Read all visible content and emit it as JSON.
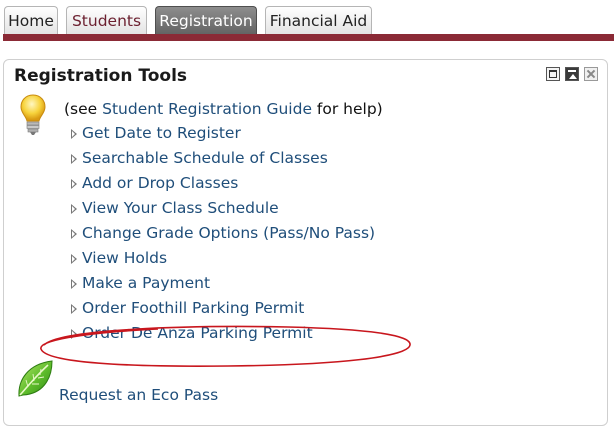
{
  "tabs": {
    "home": "Home",
    "students": "Students",
    "registration": "Registration",
    "financial_aid": "Financial Aid"
  },
  "portlet": {
    "title": "Registration Tools",
    "help_prefix": "(see ",
    "help_link": "Student Registration Guide",
    "help_suffix": " for help)",
    "items": [
      "Get Date to Register",
      "Searchable Schedule of Classes",
      "Add or Drop Classes",
      "View Your Class Schedule",
      "Change Grade Options (Pass/No Pass)",
      "View Holds",
      "Make a Payment",
      "Order Foothill Parking Permit",
      "Order De Anza Parking Permit"
    ],
    "eco_pass": "Request an Eco Pass"
  },
  "colors": {
    "tab_bar": "#8b2a36",
    "link": "#1f4e7a",
    "annotation": "#c8161d"
  },
  "icons": [
    "lightbulb-icon",
    "leaf-icon",
    "maximize-icon",
    "minimize-icon",
    "close-icon",
    "arrow-bullet-icon"
  ]
}
